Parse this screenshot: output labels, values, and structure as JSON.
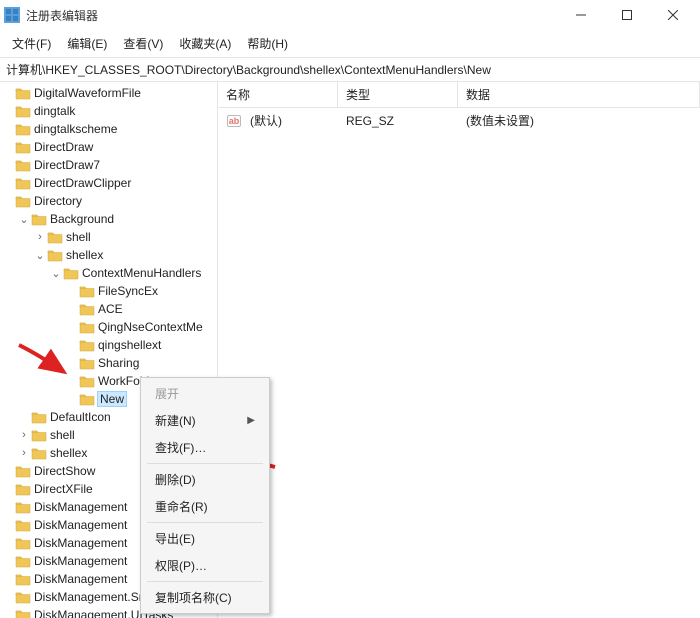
{
  "app": {
    "title": "注册表编辑器"
  },
  "menubar": {
    "file": "文件(F)",
    "edit": "编辑(E)",
    "view": "查看(V)",
    "favorites": "收藏夹(A)",
    "help": "帮助(H)"
  },
  "address": {
    "path": "计算机\\HKEY_CLASSES_ROOT\\Directory\\Background\\shellex\\ContextMenuHandlers\\New"
  },
  "list": {
    "columns": {
      "name": "名称",
      "type": "类型",
      "data": "数据"
    },
    "rows": [
      {
        "name": "(默认)",
        "type": "REG_SZ",
        "data": "(数值未设置)"
      }
    ]
  },
  "tree": {
    "items": [
      {
        "indent": 0,
        "exp": "",
        "label": "DigitalWaveformFile"
      },
      {
        "indent": 0,
        "exp": "",
        "label": "dingtalk"
      },
      {
        "indent": 0,
        "exp": "",
        "label": "dingtalkscheme"
      },
      {
        "indent": 0,
        "exp": "",
        "label": "DirectDraw"
      },
      {
        "indent": 0,
        "exp": "",
        "label": "DirectDraw7"
      },
      {
        "indent": 0,
        "exp": "",
        "label": "DirectDrawClipper"
      },
      {
        "indent": 0,
        "exp": "",
        "label": "Directory"
      },
      {
        "indent": 1,
        "exp": "v",
        "label": "Background"
      },
      {
        "indent": 2,
        "exp": ">",
        "label": "shell"
      },
      {
        "indent": 2,
        "exp": "v",
        "label": "shellex"
      },
      {
        "indent": 3,
        "exp": "v",
        "label": "ContextMenuHandlers"
      },
      {
        "indent": 4,
        "exp": "",
        "label": "FileSyncEx"
      },
      {
        "indent": 4,
        "exp": "",
        "label": "ACE"
      },
      {
        "indent": 4,
        "exp": "",
        "label": "QingNseContextMe"
      },
      {
        "indent": 4,
        "exp": "",
        "label": "qingshellext"
      },
      {
        "indent": 4,
        "exp": "",
        "label": "Sharing"
      },
      {
        "indent": 4,
        "exp": "",
        "label": "WorkFolders"
      },
      {
        "indent": 4,
        "exp": "",
        "label": "New",
        "selected": true
      },
      {
        "indent": 1,
        "exp": "",
        "label": "DefaultIcon"
      },
      {
        "indent": 1,
        "exp": ">",
        "label": "shell"
      },
      {
        "indent": 1,
        "exp": ">",
        "label": "shellex"
      },
      {
        "indent": 0,
        "exp": "",
        "label": "DirectShow"
      },
      {
        "indent": 0,
        "exp": "",
        "label": "DirectXFile"
      },
      {
        "indent": 0,
        "exp": "",
        "label": "DiskManagement"
      },
      {
        "indent": 0,
        "exp": "",
        "label": "DiskManagement"
      },
      {
        "indent": 0,
        "exp": "",
        "label": "DiskManagement"
      },
      {
        "indent": 0,
        "exp": "",
        "label": "DiskManagement"
      },
      {
        "indent": 0,
        "exp": "",
        "label": "DiskManagement"
      },
      {
        "indent": 0,
        "exp": "",
        "label": "DiskManagement.SnapInExtens"
      },
      {
        "indent": 0,
        "exp": "",
        "label": "DiskManagement.UITasks"
      }
    ]
  },
  "context_menu": {
    "expand": "展开",
    "new": "新建(N)",
    "find": "查找(F)…",
    "delete": "删除(D)",
    "rename": "重命名(R)",
    "export": "导出(E)",
    "permissions": "权限(P)…",
    "copy_key_name": "复制项名称(C)"
  }
}
